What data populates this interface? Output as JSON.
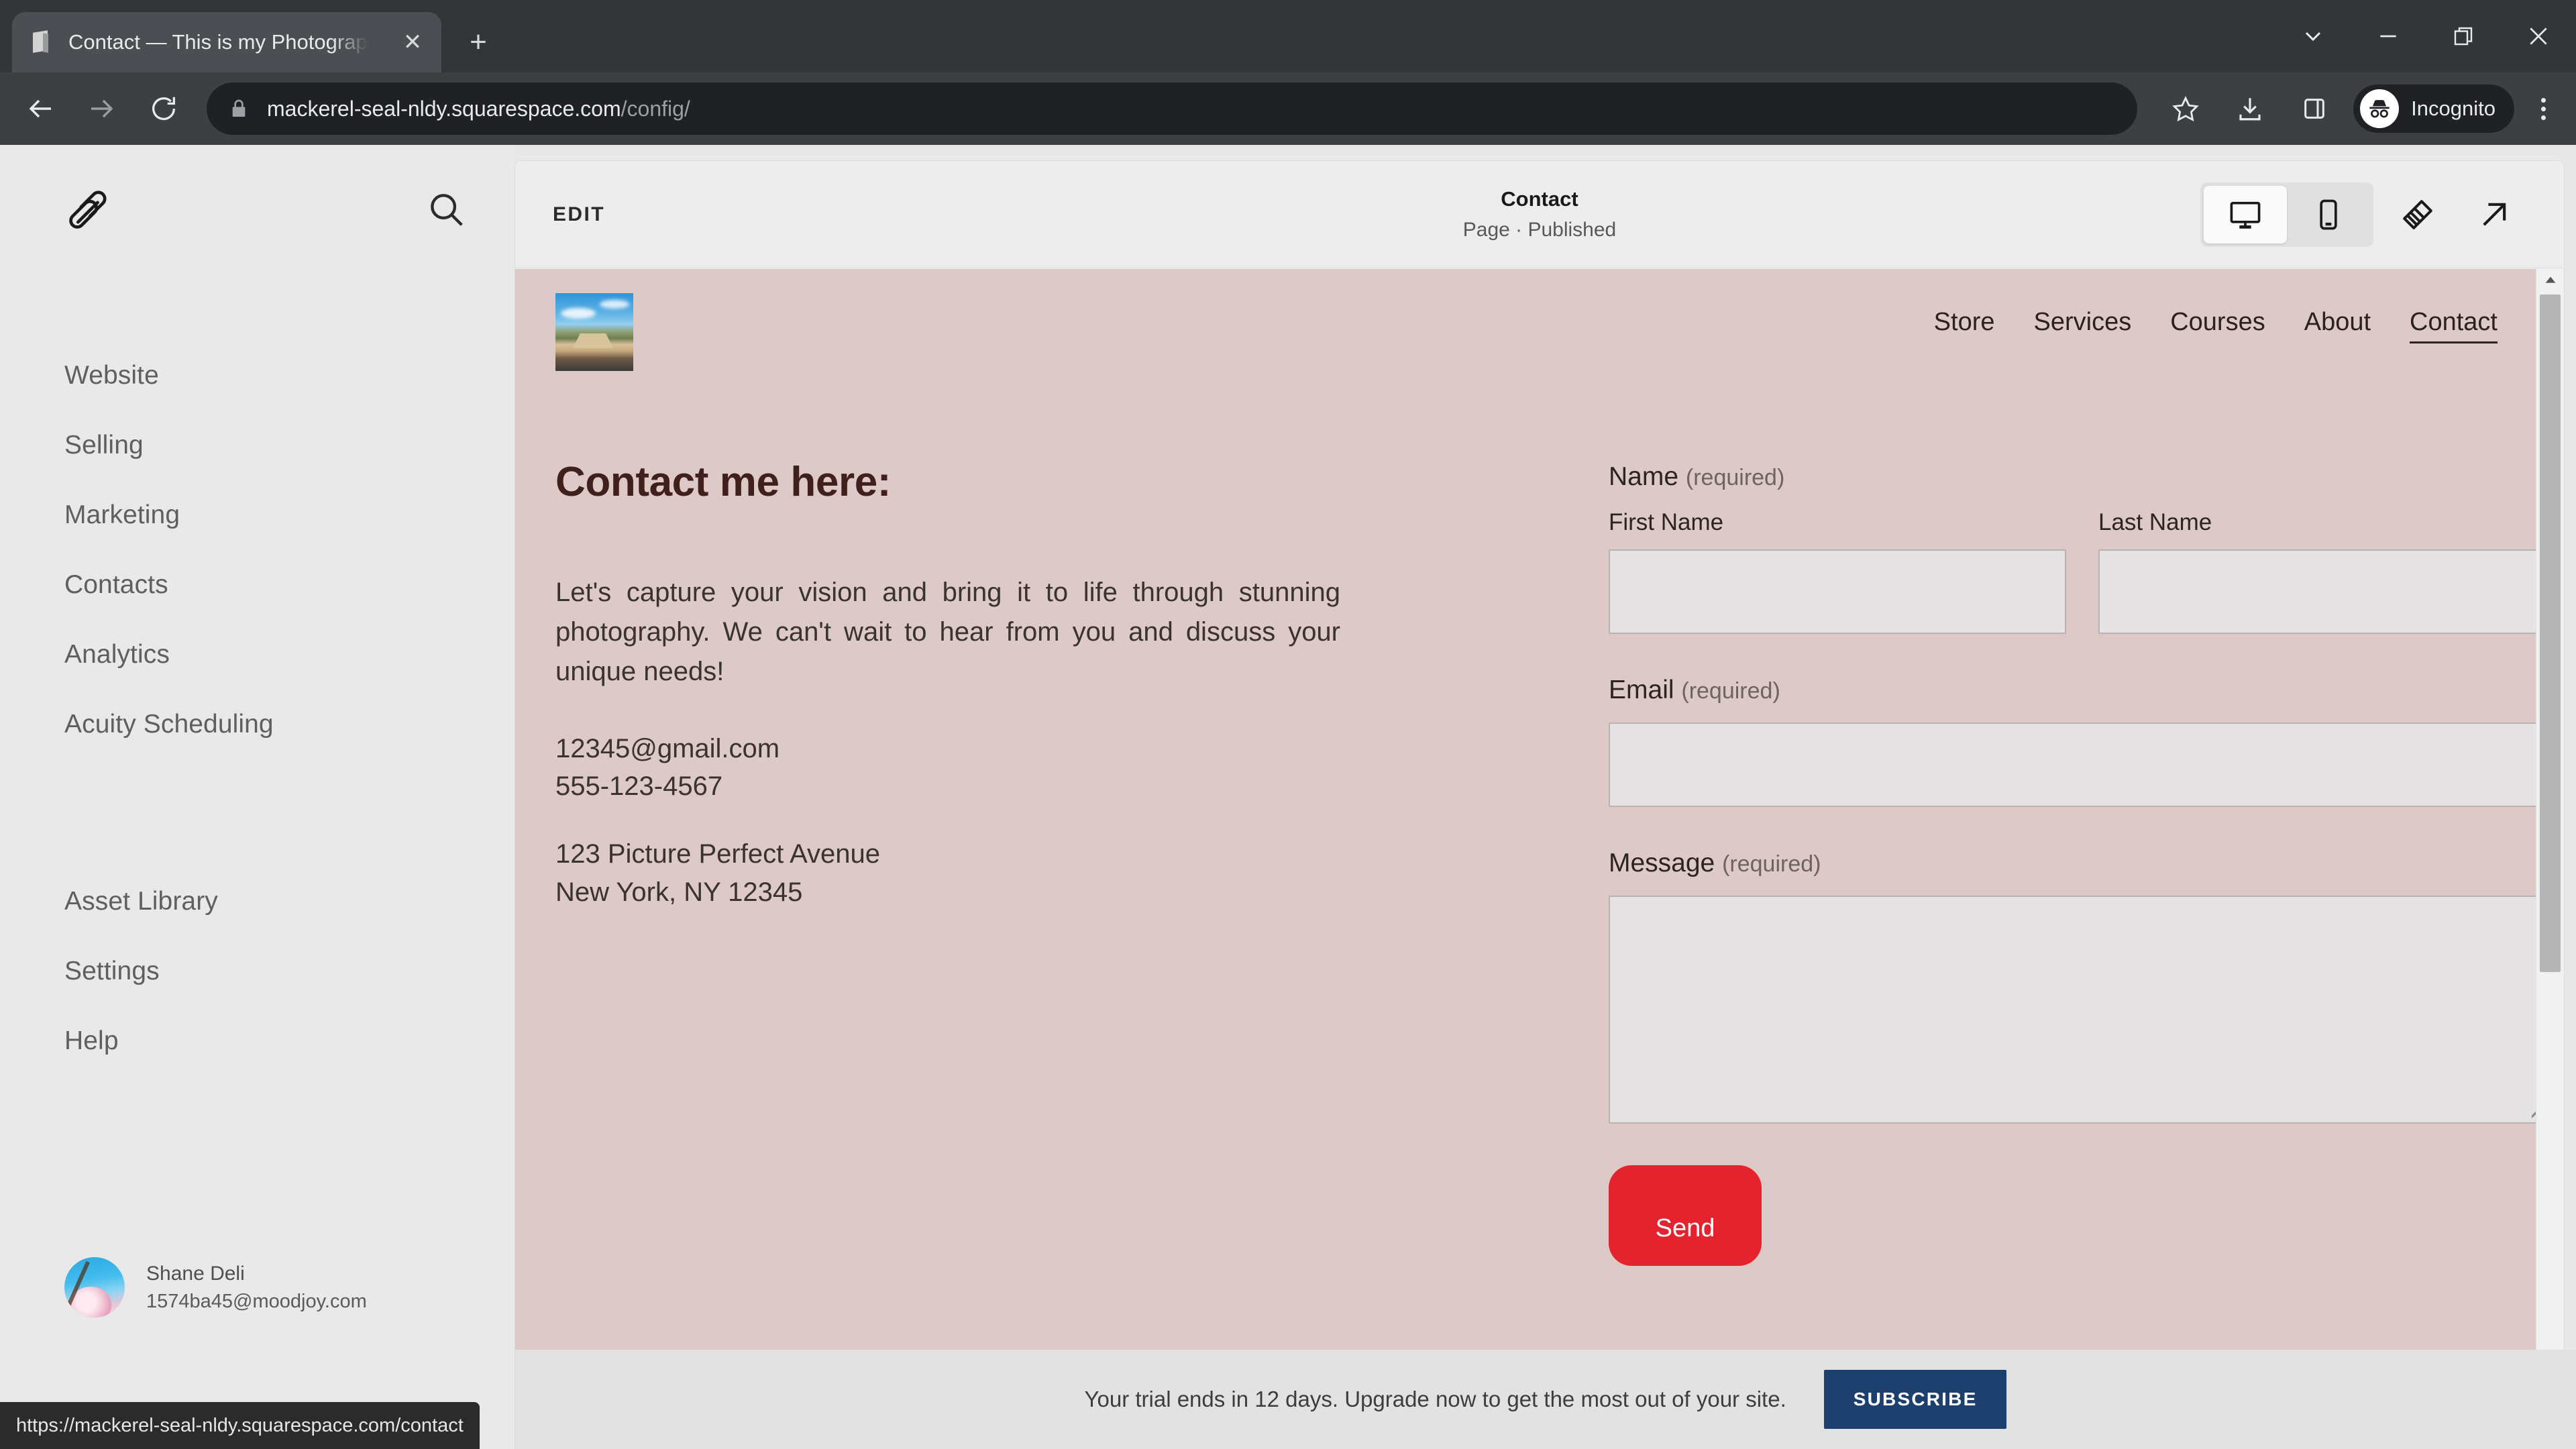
{
  "browser": {
    "tab": {
      "title": "Contact — This is my Photograp",
      "favicon_icon": "box-favicon",
      "close_icon": "close-icon"
    },
    "new_tab_icon": "plus-icon",
    "window_controls": [
      {
        "name": "tab-search-button",
        "icon": "chevron-down-icon",
        "glyph": "v"
      },
      {
        "name": "minimize-button",
        "icon": "minimize-icon",
        "glyph": "–"
      },
      {
        "name": "maximize-button",
        "icon": "restore-icon",
        "glyph": "❐"
      },
      {
        "name": "close-window-button",
        "icon": "close-icon",
        "glyph": "✕"
      }
    ],
    "nav": {
      "back_icon": "back-arrow-icon",
      "forward_icon": "forward-arrow-icon",
      "reload_icon": "reload-icon"
    },
    "omnibox": {
      "lock_icon": "lock-icon",
      "host": "mackerel-seal-nldy.squarespace.com",
      "path": "/config/"
    },
    "actions": {
      "bookmark_icon": "star-icon",
      "download_icon": "download-icon",
      "sidepanel_icon": "side-panel-icon",
      "incognito_label": "Incognito",
      "incognito_icon": "incognito-icon",
      "menu_icon": "kebab-menu-icon"
    },
    "status_url": "https://mackerel-seal-nldy.squarespace.com/contact"
  },
  "sidebar": {
    "logo_icon": "squarespace-logo-icon",
    "search_icon": "search-icon",
    "items": [
      {
        "label": "Website"
      },
      {
        "label": "Selling"
      },
      {
        "label": "Marketing"
      },
      {
        "label": "Contacts"
      },
      {
        "label": "Analytics"
      },
      {
        "label": "Acuity Scheduling"
      }
    ],
    "items_secondary": [
      {
        "label": "Asset Library"
      },
      {
        "label": "Settings"
      },
      {
        "label": "Help"
      }
    ],
    "user": {
      "name": "Shane Deli",
      "email": "1574ba45@moodjoy.com",
      "avatar_icon": "user-avatar"
    }
  },
  "panel": {
    "edit_label": "EDIT",
    "page_title": "Contact",
    "page_status": "Page · Published",
    "view_desktop_icon": "desktop-icon",
    "view_mobile_icon": "mobile-icon",
    "style_icon": "paintbrush-icon",
    "open_icon": "external-link-arrow-icon",
    "active_view": "desktop"
  },
  "site": {
    "logo_icon": "site-logo-image",
    "nav": [
      {
        "label": "Store",
        "active": false
      },
      {
        "label": "Services",
        "active": false
      },
      {
        "label": "Courses",
        "active": false
      },
      {
        "label": "About",
        "active": false
      },
      {
        "label": "Contact",
        "active": true
      }
    ],
    "heading": "Contact me here:",
    "paragraph": "Let's capture your vision and bring it to life through stunning photography. We can't wait to hear from you and discuss your unique needs!",
    "email": "12345@gmail.com",
    "phone": "555-123-4567",
    "address_line1": "123 Picture Perfect Avenue",
    "address_line2": "New York, NY 12345",
    "form": {
      "name_label": "Name",
      "name_required": "(required)",
      "first_name_label": "First Name",
      "last_name_label": "Last Name",
      "first_name_value": "",
      "last_name_value": "",
      "email_label": "Email",
      "email_required": "(required)",
      "email_value": "",
      "message_label": "Message",
      "message_required": "(required)",
      "message_value": "",
      "send_label": "Send",
      "send_color": "#e5232f"
    }
  },
  "trial": {
    "message": "Your trial ends in 12 days. Upgrade now to get the most out of your site.",
    "subscribe_label": "SUBSCRIBE",
    "subscribe_color": "#1c3f6e"
  },
  "theme": {
    "page_bg": "#ddc9c7",
    "chrome_bg": "#3c4043",
    "sidebar_bg": "#e9e9e9",
    "input_bg": "#e5e3e3"
  }
}
